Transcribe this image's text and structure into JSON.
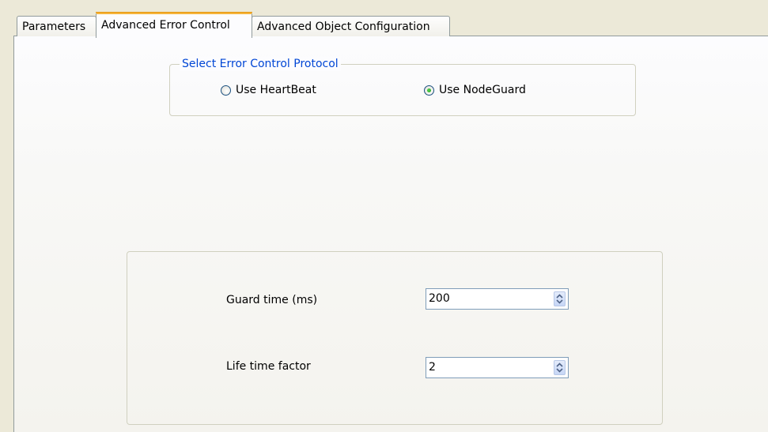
{
  "tabs": [
    {
      "label": "Parameters",
      "active": false
    },
    {
      "label": "Advanced Error Control",
      "active": true
    },
    {
      "label": "Advanced Object Configuration",
      "active": false
    }
  ],
  "protocol_group": {
    "title": "Select Error Control Protocol",
    "options": [
      {
        "label": "Use HeartBeat",
        "selected": false
      },
      {
        "label": "Use NodeGuard",
        "selected": true
      }
    ]
  },
  "fields": {
    "guard_time": {
      "label": "Guard time (ms)",
      "value": "200"
    },
    "life_time_factor": {
      "label": "Life time factor",
      "value": "2"
    }
  },
  "colors": {
    "active_tab_accent": "#f5b43b",
    "group_title": "#0046d5",
    "radio_selected": "#21a121"
  },
  "icons": {
    "radio": "radio-button-icon",
    "spinner": "spinner-arrows-icon"
  }
}
